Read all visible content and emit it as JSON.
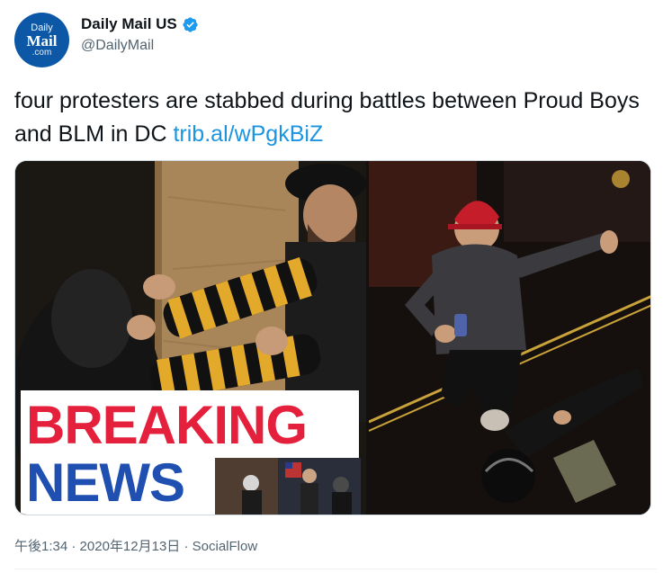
{
  "account": {
    "avatar_line1": "Daily",
    "avatar_line2": "Mail",
    "avatar_line3": ".com",
    "display_name": "Daily Mail US",
    "handle": "@DailyMail",
    "verified": true
  },
  "tweet": {
    "text": "four protesters are stabbed during battles between Proud Boys and BLM in DC",
    "link": "trib.al/wPgkBiZ"
  },
  "media": {
    "breaking_word": "BREAKING",
    "news_word": "NEWS"
  },
  "meta": {
    "time": "午後1:34",
    "separator": "·",
    "date": "2020年12月13日",
    "source": "SocialFlow"
  },
  "colors": {
    "link": "#1b95e0",
    "verified": "#1d9bf0",
    "breaking": "#e5203c",
    "news": "#1f4fb0"
  },
  "icons": {
    "verified": "verified-badge-icon"
  }
}
